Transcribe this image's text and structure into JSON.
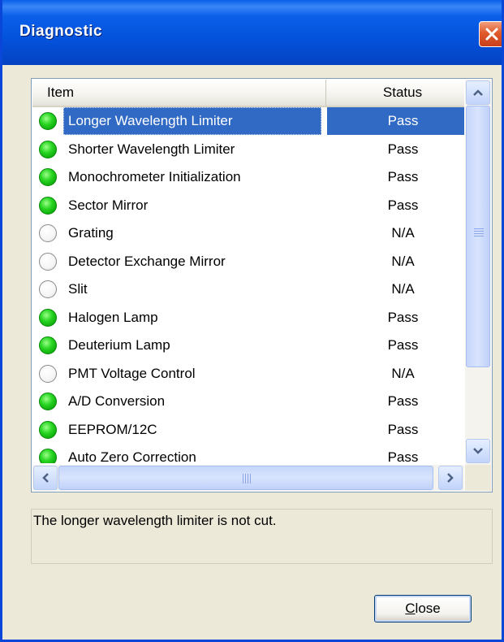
{
  "window": {
    "title": "Diagnostic"
  },
  "list": {
    "columns": {
      "item": "Item",
      "status": "Status"
    },
    "rows": [
      {
        "label": "Longer Wavelength Limiter",
        "status": "Pass",
        "indicator": "green",
        "selected": true
      },
      {
        "label": "Shorter Wavelength Limiter",
        "status": "Pass",
        "indicator": "green",
        "selected": false
      },
      {
        "label": "Monochrometer Initialization",
        "status": "Pass",
        "indicator": "green",
        "selected": false
      },
      {
        "label": "Sector Mirror",
        "status": "Pass",
        "indicator": "green",
        "selected": false
      },
      {
        "label": "Grating",
        "status": "N/A",
        "indicator": "white",
        "selected": false
      },
      {
        "label": "Detector Exchange Mirror",
        "status": "N/A",
        "indicator": "white",
        "selected": false
      },
      {
        "label": "Slit",
        "status": "N/A",
        "indicator": "white",
        "selected": false
      },
      {
        "label": "Halogen Lamp",
        "status": "Pass",
        "indicator": "green",
        "selected": false
      },
      {
        "label": "Deuterium Lamp",
        "status": "Pass",
        "indicator": "green",
        "selected": false
      },
      {
        "label": "PMT Voltage Control",
        "status": "N/A",
        "indicator": "white",
        "selected": false
      },
      {
        "label": "A/D Conversion",
        "status": "Pass",
        "indicator": "green",
        "selected": false
      },
      {
        "label": "EEPROM/12C",
        "status": "Pass",
        "indicator": "green",
        "selected": false
      },
      {
        "label": "Auto Zero Correction",
        "status": "Pass",
        "indicator": "green",
        "selected": false
      }
    ]
  },
  "description": "The longer wavelength limiter is not cut.",
  "buttons": {
    "close_label": "Close",
    "close_mnemonic": "C",
    "close_rest": "lose"
  },
  "colors": {
    "title_bar": "#0452dc",
    "selection": "#316ac5",
    "pass_indicator": "#2ad624",
    "na_indicator": "#ffffff"
  }
}
